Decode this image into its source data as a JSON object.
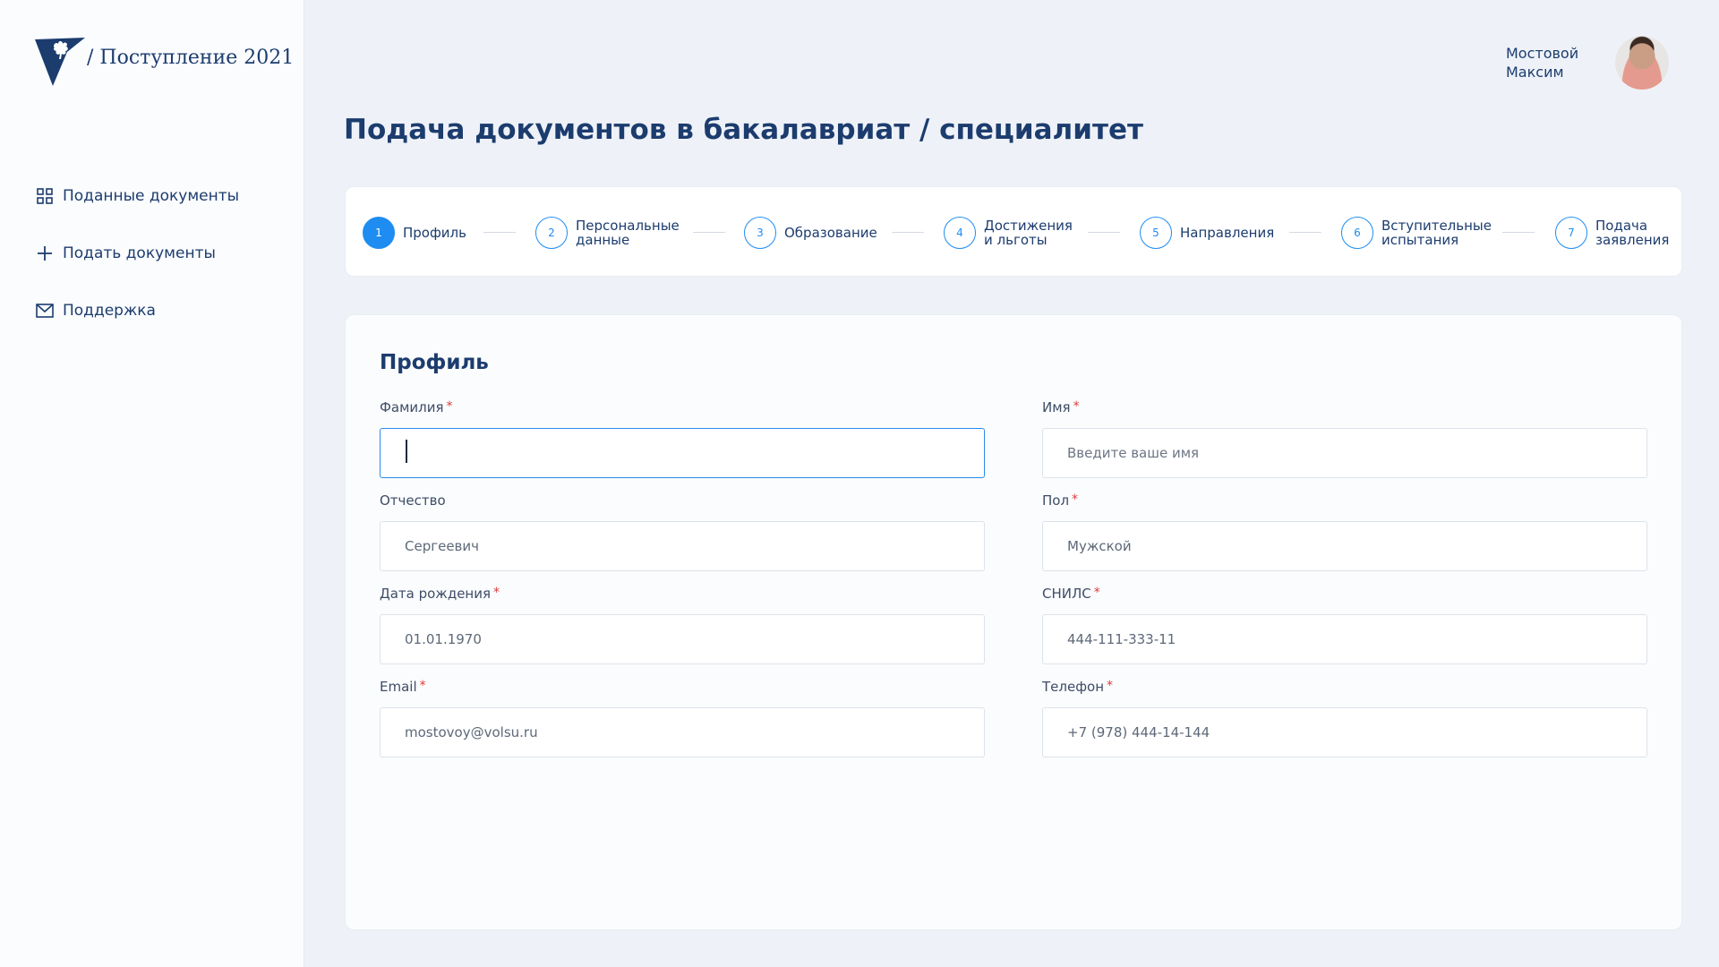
{
  "brand": {
    "text": "/ Поступление 2021",
    "logo_icon": "oak-leaf-pennant-logo"
  },
  "sidebar": {
    "items": [
      {
        "label": "Поданные документы",
        "icon": "grid-icon"
      },
      {
        "label": "Подать документы",
        "icon": "plus-icon"
      },
      {
        "label": "Поддержка",
        "icon": "mail-icon"
      }
    ]
  },
  "user": {
    "name": "Мостовой Максим"
  },
  "page": {
    "title": "Подача документов в бакалавриат / специалитет"
  },
  "stepper": {
    "active_step": 1,
    "steps": [
      {
        "num": "1",
        "label": "Профиль"
      },
      {
        "num": "2",
        "label": "Персональные\nданные"
      },
      {
        "num": "3",
        "label": "Образование"
      },
      {
        "num": "4",
        "label": "Достижения\nи льготы"
      },
      {
        "num": "5",
        "label": "Направления"
      },
      {
        "num": "6",
        "label": "Вступительные\nиспытания"
      },
      {
        "num": "7",
        "label": "Подача\nзаявления"
      }
    ]
  },
  "form": {
    "title": "Профиль",
    "required_mark": "*",
    "fields": {
      "last_name": {
        "label": "Фамилия",
        "value": "",
        "placeholder": ""
      },
      "first_name": {
        "label": "Имя",
        "value": "",
        "placeholder": "Введите ваше имя"
      },
      "patronymic": {
        "label": "Отчество",
        "value": "Сергеевич",
        "placeholder": ""
      },
      "gender": {
        "label": "Пол",
        "value": "Мужской",
        "placeholder": ""
      },
      "birth_date": {
        "label": "Дата рождения",
        "value": "01.01.1970",
        "placeholder": ""
      },
      "snils": {
        "label": "СНИЛС",
        "value": "444-111-333-11",
        "placeholder": ""
      },
      "email": {
        "label": "Email",
        "value": "mostovoy@volsu.ru",
        "placeholder": ""
      },
      "phone": {
        "label": "Телефон",
        "value": "+7 (978) 444-14-144",
        "placeholder": ""
      }
    }
  },
  "colors": {
    "accent": "#1e8cf0",
    "text_primary": "#1c3c6e",
    "required": "#e03a3a",
    "background": "#eef2f8"
  }
}
